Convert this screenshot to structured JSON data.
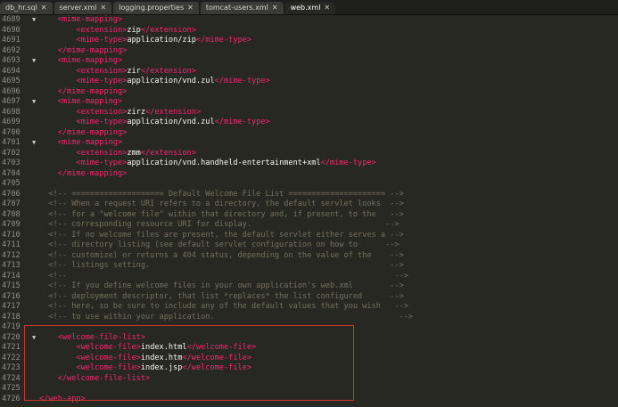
{
  "tabs": [
    {
      "label": "db_hr.sql",
      "active": false
    },
    {
      "label": "server.xml",
      "active": false
    },
    {
      "label": "logging.properties",
      "active": false
    },
    {
      "label": "tomcat-users.xml",
      "active": false
    },
    {
      "label": "web.xml",
      "active": true
    }
  ],
  "lines": [
    {
      "num": "4689",
      "fold": "▼",
      "tokens": [
        {
          "t": "ws",
          "v": "    "
        },
        {
          "t": "tag",
          "v": "<mime-mapping>"
        }
      ]
    },
    {
      "num": "4690",
      "fold": "",
      "tokens": [
        {
          "t": "ws",
          "v": "        "
        },
        {
          "t": "tag",
          "v": "<extension>"
        },
        {
          "t": "text",
          "v": "zip"
        },
        {
          "t": "tag",
          "v": "</extension>"
        }
      ]
    },
    {
      "num": "4691",
      "fold": "",
      "tokens": [
        {
          "t": "ws",
          "v": "        "
        },
        {
          "t": "tag",
          "v": "<mime-type>"
        },
        {
          "t": "text",
          "v": "application/zip"
        },
        {
          "t": "tag",
          "v": "</mime-type>"
        }
      ]
    },
    {
      "num": "4692",
      "fold": "",
      "tokens": [
        {
          "t": "ws",
          "v": "    "
        },
        {
          "t": "tag",
          "v": "</mime-mapping>"
        }
      ]
    },
    {
      "num": "4693",
      "fold": "▼",
      "tokens": [
        {
          "t": "ws",
          "v": "    "
        },
        {
          "t": "tag",
          "v": "<mime-mapping>"
        }
      ]
    },
    {
      "num": "4694",
      "fold": "",
      "tokens": [
        {
          "t": "ws",
          "v": "        "
        },
        {
          "t": "tag",
          "v": "<extension>"
        },
        {
          "t": "text",
          "v": "zir"
        },
        {
          "t": "tag",
          "v": "</extension>"
        }
      ]
    },
    {
      "num": "4695",
      "fold": "",
      "tokens": [
        {
          "t": "ws",
          "v": "        "
        },
        {
          "t": "tag",
          "v": "<mime-type>"
        },
        {
          "t": "text",
          "v": "application/vnd.zul"
        },
        {
          "t": "tag",
          "v": "</mime-type>"
        }
      ]
    },
    {
      "num": "4696",
      "fold": "",
      "tokens": [
        {
          "t": "ws",
          "v": "    "
        },
        {
          "t": "tag",
          "v": "</mime-mapping>"
        }
      ]
    },
    {
      "num": "4697",
      "fold": "▼",
      "tokens": [
        {
          "t": "ws",
          "v": "    "
        },
        {
          "t": "tag",
          "v": "<mime-mapping>"
        }
      ]
    },
    {
      "num": "4698",
      "fold": "",
      "tokens": [
        {
          "t": "ws",
          "v": "        "
        },
        {
          "t": "tag",
          "v": "<extension>"
        },
        {
          "t": "text",
          "v": "zirz"
        },
        {
          "t": "tag",
          "v": "</extension>"
        }
      ]
    },
    {
      "num": "4699",
      "fold": "",
      "tokens": [
        {
          "t": "ws",
          "v": "        "
        },
        {
          "t": "tag",
          "v": "<mime-type>"
        },
        {
          "t": "text",
          "v": "application/vnd.zul"
        },
        {
          "t": "tag",
          "v": "</mime-type>"
        }
      ]
    },
    {
      "num": "4700",
      "fold": "",
      "tokens": [
        {
          "t": "ws",
          "v": "    "
        },
        {
          "t": "tag",
          "v": "</mime-mapping>"
        }
      ]
    },
    {
      "num": "4701",
      "fold": "▼",
      "tokens": [
        {
          "t": "ws",
          "v": "    "
        },
        {
          "t": "tag",
          "v": "<mime-mapping>"
        }
      ]
    },
    {
      "num": "4702",
      "fold": "",
      "tokens": [
        {
          "t": "ws",
          "v": "        "
        },
        {
          "t": "tag",
          "v": "<extension>"
        },
        {
          "t": "text",
          "v": "zmm"
        },
        {
          "t": "tag",
          "v": "</extension>"
        }
      ]
    },
    {
      "num": "4703",
      "fold": "",
      "tokens": [
        {
          "t": "ws",
          "v": "        "
        },
        {
          "t": "tag",
          "v": "<mime-type>"
        },
        {
          "t": "text",
          "v": "application/vnd.handheld-entertainment+xml"
        },
        {
          "t": "tag",
          "v": "</mime-type>"
        }
      ]
    },
    {
      "num": "4704",
      "fold": "",
      "tokens": [
        {
          "t": "ws",
          "v": "    "
        },
        {
          "t": "tag",
          "v": "</mime-mapping>"
        }
      ]
    },
    {
      "num": "4705",
      "fold": "",
      "tokens": []
    },
    {
      "num": "4706",
      "fold": "",
      "tokens": [
        {
          "t": "ws",
          "v": "  "
        },
        {
          "t": "comment",
          "v": "<!-- ==================== Default Welcome File List ===================== -->"
        }
      ]
    },
    {
      "num": "4707",
      "fold": "",
      "tokens": [
        {
          "t": "ws",
          "v": "  "
        },
        {
          "t": "comment",
          "v": "<!-- When a request URI refers to a directory, the default servlet looks  -->"
        }
      ]
    },
    {
      "num": "4708",
      "fold": "",
      "tokens": [
        {
          "t": "ws",
          "v": "  "
        },
        {
          "t": "comment",
          "v": "<!-- for a \"welcome file\" within that directory and, if present, to the   -->"
        }
      ]
    },
    {
      "num": "4709",
      "fold": "",
      "tokens": [
        {
          "t": "ws",
          "v": "  "
        },
        {
          "t": "comment",
          "v": "<!-- corresponding resource URI for display.                             -->"
        }
      ]
    },
    {
      "num": "4710",
      "fold": "",
      "tokens": [
        {
          "t": "ws",
          "v": "  "
        },
        {
          "t": "comment",
          "v": "<!-- If no welcome files are present, the default servlet either serves a -->"
        }
      ]
    },
    {
      "num": "4711",
      "fold": "",
      "tokens": [
        {
          "t": "ws",
          "v": "  "
        },
        {
          "t": "comment",
          "v": "<!-- directory listing (see default servlet configuration on how to      -->"
        }
      ]
    },
    {
      "num": "4712",
      "fold": "",
      "tokens": [
        {
          "t": "ws",
          "v": "  "
        },
        {
          "t": "comment",
          "v": "<!-- customize) or returns a 404 status, depending on the value of the    -->"
        }
      ]
    },
    {
      "num": "4713",
      "fold": "",
      "tokens": [
        {
          "t": "ws",
          "v": "  "
        },
        {
          "t": "comment",
          "v": "<!-- listings setting.                                                    -->"
        }
      ]
    },
    {
      "num": "4714",
      "fold": "",
      "tokens": [
        {
          "t": "ws",
          "v": "  "
        },
        {
          "t": "comment",
          "v": "<!--                                                                       -->"
        }
      ]
    },
    {
      "num": "4715",
      "fold": "",
      "tokens": [
        {
          "t": "ws",
          "v": "  "
        },
        {
          "t": "comment",
          "v": "<!-- If you define welcome files in your own application's web.xml        -->"
        }
      ]
    },
    {
      "num": "4716",
      "fold": "",
      "tokens": [
        {
          "t": "ws",
          "v": "  "
        },
        {
          "t": "comment",
          "v": "<!-- deployment descriptor, that list *replaces* the list configured      -->"
        }
      ]
    },
    {
      "num": "4717",
      "fold": "",
      "tokens": [
        {
          "t": "ws",
          "v": "  "
        },
        {
          "t": "comment",
          "v": "<!-- here, so be sure to include any of the default values that you wish   -->"
        }
      ]
    },
    {
      "num": "4718",
      "fold": "",
      "tokens": [
        {
          "t": "ws",
          "v": "  "
        },
        {
          "t": "comment",
          "v": "<!-- to use within your application.                                        -->"
        }
      ]
    },
    {
      "num": "4719",
      "fold": "",
      "tokens": []
    },
    {
      "num": "4720",
      "fold": "▼",
      "tokens": [
        {
          "t": "ws",
          "v": "    "
        },
        {
          "t": "tag",
          "v": "<welcome-file-list>"
        }
      ]
    },
    {
      "num": "4721",
      "fold": "",
      "tokens": [
        {
          "t": "ws",
          "v": "        "
        },
        {
          "t": "tag",
          "v": "<welcome-file>"
        },
        {
          "t": "text",
          "v": "index.html"
        },
        {
          "t": "tag",
          "v": "</welcome-file>"
        }
      ]
    },
    {
      "num": "4722",
      "fold": "",
      "tokens": [
        {
          "t": "ws",
          "v": "        "
        },
        {
          "t": "tag",
          "v": "<welcome-file>"
        },
        {
          "t": "text",
          "v": "index.htm"
        },
        {
          "t": "tag",
          "v": "</welcome-file>"
        }
      ]
    },
    {
      "num": "4723",
      "fold": "",
      "tokens": [
        {
          "t": "ws",
          "v": "        "
        },
        {
          "t": "tag",
          "v": "<welcome-file>"
        },
        {
          "t": "text",
          "v": "index.jsp"
        },
        {
          "t": "tag",
          "v": "</welcome-file>"
        }
      ]
    },
    {
      "num": "4724",
      "fold": "",
      "tokens": [
        {
          "t": "ws",
          "v": "    "
        },
        {
          "t": "tag",
          "v": "</welcome-file-list>"
        }
      ]
    },
    {
      "num": "4725",
      "fold": "",
      "tokens": []
    },
    {
      "num": "4726",
      "fold": "",
      "tokens": [
        {
          "t": "tag",
          "v": "</web-app>"
        }
      ]
    }
  ],
  "colors": {
    "background": "#272822",
    "tag": "#f92672",
    "comment": "#75715e",
    "text": "#f8f8f2",
    "highlight": "#c0392b"
  }
}
